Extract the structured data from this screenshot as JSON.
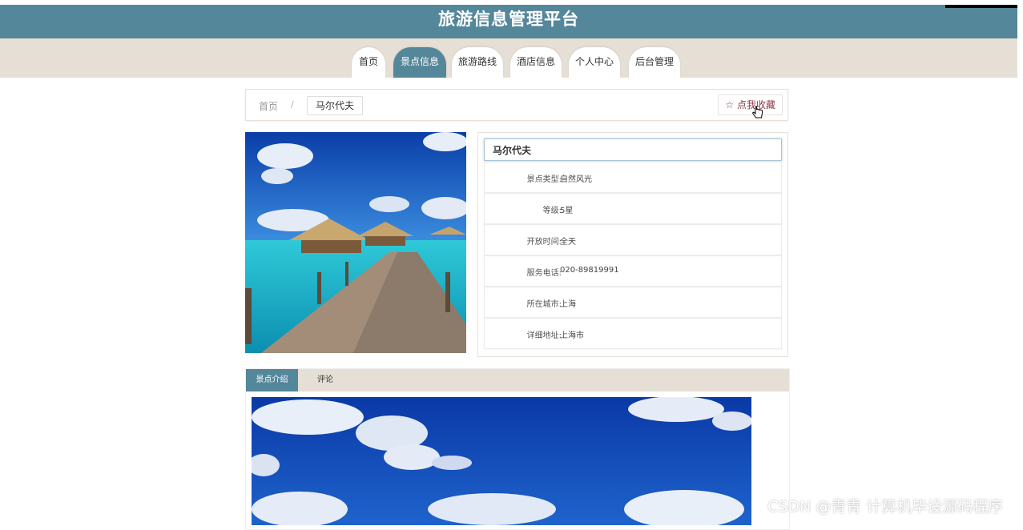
{
  "header": {
    "title": "旅游信息管理平台"
  },
  "nav": {
    "tabs": [
      {
        "label": "首页"
      },
      {
        "label": "景点信息"
      },
      {
        "label": "旅游路线"
      },
      {
        "label": "酒店信息"
      },
      {
        "label": "个人中心"
      },
      {
        "label": "后台管理"
      }
    ],
    "active_index": 1
  },
  "breadcrumb": {
    "home": "首页",
    "separator": "/",
    "current": "马尔代夫"
  },
  "favorite_button": {
    "label": "☆ 点我收藏"
  },
  "attraction": {
    "name": "马尔代夫",
    "fields": [
      {
        "label": "景点类型:",
        "value": "自然风光"
      },
      {
        "label": "等级:",
        "value": "5星"
      },
      {
        "label": "开放时间:",
        "value": "全天"
      },
      {
        "label": "服务电话:",
        "value": "020-89819991"
      },
      {
        "label": "所在城市:",
        "value": "上海"
      },
      {
        "label": "详细地址:",
        "value": "上海市"
      }
    ]
  },
  "detail_tabs": [
    {
      "label": "景点介绍"
    },
    {
      "label": "评论"
    }
  ],
  "watermark": "CSDN @青青  计算机毕设源码程序",
  "colors": {
    "accent": "#55879a",
    "nav_bg": "#e6dfd6"
  }
}
